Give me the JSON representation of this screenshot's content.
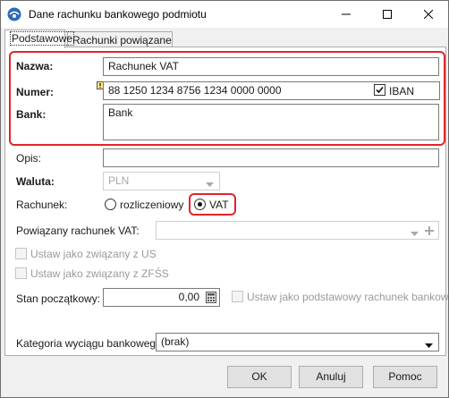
{
  "window": {
    "title": "Dane rachunku bankowego podmiotu"
  },
  "tabs": [
    {
      "label": "Podstawowe",
      "active": true
    },
    {
      "label": "Rachunki powiązane",
      "active": false
    }
  ],
  "form": {
    "nazwa_label": "Nazwa:",
    "nazwa_value": "Rachunek VAT",
    "numer_label": "Numer:",
    "numer_value": "88 1250 1234 8756 1234 0000 0000",
    "iban_label": "IBAN",
    "iban_checked": true,
    "bank_label": "Bank:",
    "bank_value": "Bank",
    "opis_label": "Opis:",
    "opis_value": "",
    "waluta_label": "Waluta:",
    "waluta_value": "PLN",
    "rachunek_label": "Rachunek:",
    "rachunek_options": [
      "rozliczeniowy",
      "VAT"
    ],
    "rachunek_selected": "VAT",
    "powiazany_label": "Powiązany rachunek VAT:",
    "powiazany_value": "",
    "us_label": "Ustaw jako związany z US",
    "zfss_label": "Ustaw jako związany z ZFŚS",
    "stan_label": "Stan początkowy:",
    "stan_value": "0,00",
    "podstawowy_label": "Ustaw jako podstawowy rachunek bankowy",
    "kategoria_label": "Kategoria wyciągu bankowego:",
    "kategoria_value": "(brak)"
  },
  "buttons": {
    "ok": "OK",
    "cancel": "Anuluj",
    "help": "Pomoc"
  },
  "colors": {
    "highlight": "#e2252b",
    "window_bg": "#f0f0f0"
  }
}
